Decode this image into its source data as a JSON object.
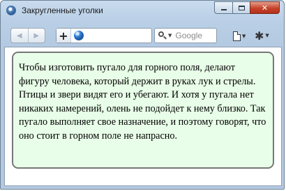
{
  "window": {
    "title": "Закругленные уголки",
    "controls": {
      "minimize": "minimize",
      "maximize": "maximize",
      "close": "✕"
    }
  },
  "toolbar": {
    "back_icon": "◀",
    "forward_icon": "▶",
    "add_icon": "+",
    "search_placeholder": "Google",
    "search_caret": "▼",
    "menu_caret": "▼",
    "gear_icon": "✱"
  },
  "page": {
    "paragraph": "Чтобы изготовить пугало для горного поля, делают фигуру человека, который держит в руках лук и стрелы. Птицы и звери видят его и убегают. И хотя у пугала нет никаких намерений, олень не подойдет к нему близко. Так пугало выполняет свое назначение, и поэтому говорят, что оно стоит в горном поле не напрасно.",
    "block_background": "#e8fee8",
    "block_border": "#777777"
  }
}
